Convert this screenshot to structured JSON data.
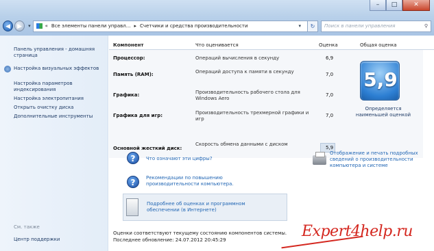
{
  "window": {
    "minimize_label": "–",
    "maximize_label": "□",
    "close_label": "✕"
  },
  "nav": {
    "back_icon": "arrow-left-icon",
    "forward_icon": "arrow-right-icon",
    "breadcrumb": [
      "Все элементы панели управл...",
      "Счетчики и средства производительности"
    ],
    "search_placeholder": "Поиск в панели управления"
  },
  "sidebar": {
    "items": [
      {
        "label": "Панель управления - домашняя страница"
      },
      {
        "label": "Настройка визуальных эффектов"
      },
      {
        "label": "Настройка параметров индексирования"
      },
      {
        "label": "Настройка электропитания"
      },
      {
        "label": "Открыть очистку диска"
      },
      {
        "label": "Дополнительные инструменты"
      }
    ],
    "see_also": "См. также",
    "support": "Центр поддержки"
  },
  "table": {
    "headers": {
      "component": "Компонент",
      "what": "Что оценивается",
      "score": "Оценка",
      "overall": "Общая оценка"
    },
    "rows": [
      {
        "component": "Процессор:",
        "what": "Операций вычисления в секунду",
        "score": "6,9"
      },
      {
        "component": "Память (RAM):",
        "what": "Операций доступа к памяти в секунду",
        "score": "7,0"
      },
      {
        "component": "Графика:",
        "what": "Производительность рабочего стола для Windows Aero",
        "score": "7,0"
      },
      {
        "component": "Графика для игр:",
        "what": "Производительность трехмерной графики и игр",
        "score": "7,0"
      },
      {
        "component": "Основной жесткий диск:",
        "what": "Скорость обмена данными с диском",
        "score": "5,9"
      }
    ]
  },
  "overall": {
    "score": "5,9",
    "caption": "Определяется наименьшей оценкой"
  },
  "links": {
    "what_numbers": "Что означают эти цифры?",
    "recommendations": "Рекомендации по повышению производительности компьютера.",
    "print": "Отображение и печать подробных сведений о производительности компьютера и системе",
    "details": "Подробнее об оценках и программном обеспечении (в Интернете)"
  },
  "footer": {
    "status": "Оценки соответствуют текущему состоянию компонентов системы.",
    "updated": "Последнее обновление: 24.07.2012 20:45:29"
  },
  "watermark": "Expert4help.ru"
}
